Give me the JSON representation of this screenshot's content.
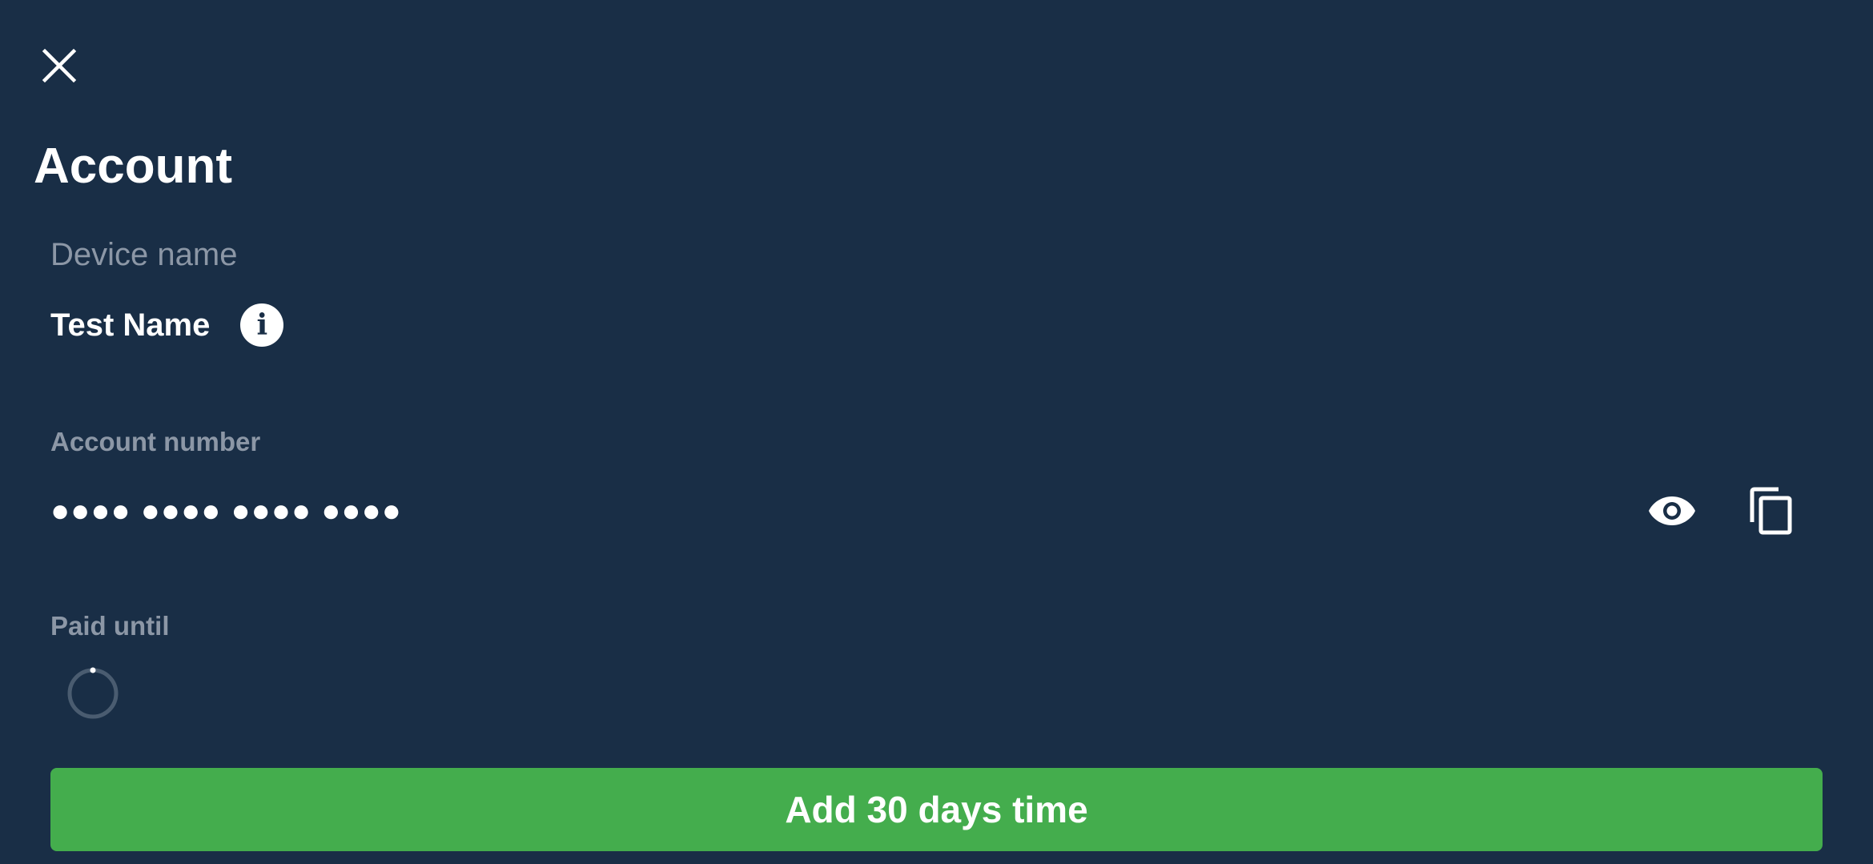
{
  "icons": {
    "close": "close-icon",
    "info": "info-icon",
    "reveal": "eye-icon",
    "copy": "copy-icon",
    "loading": "loading-spinner"
  },
  "colors": {
    "background": "#192E46",
    "label": "#8C97A6",
    "text": "#FFFFFF",
    "primary_button": "#44AD4D",
    "spinner_track": "#4A5C70"
  },
  "header": {
    "title": "Account"
  },
  "device": {
    "label": "Device name",
    "value": "Test Name"
  },
  "account": {
    "label": "Account number",
    "value": "●●●● ●●●● ●●●● ●●●●"
  },
  "paid": {
    "label": "Paid until"
  },
  "actions": {
    "add_time_label": "Add 30 days time"
  }
}
